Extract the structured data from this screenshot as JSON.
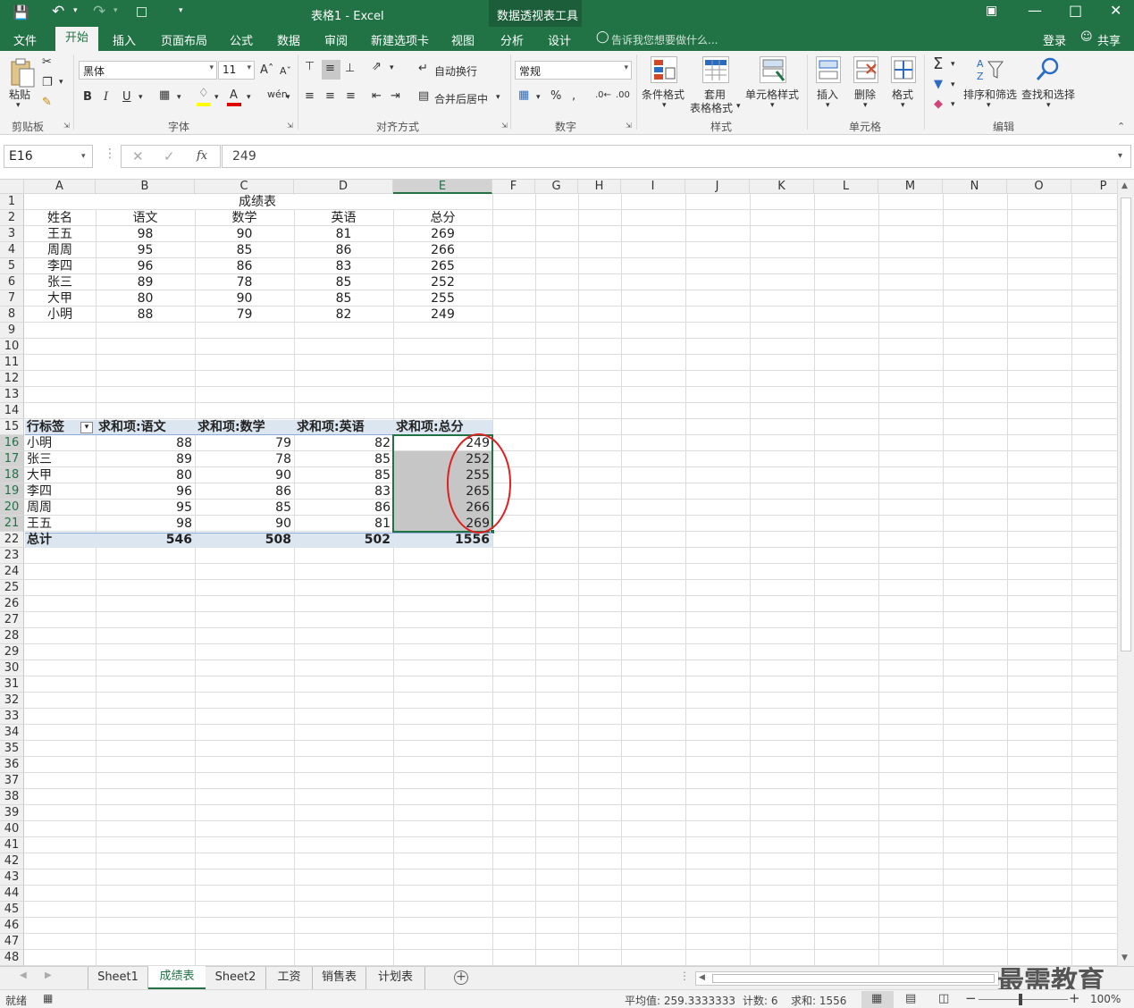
{
  "title": {
    "doc_title": "表格1 - Excel",
    "context_tool": "数据透视表工具"
  },
  "tabs": {
    "file": "文件",
    "items": [
      "开始",
      "插入",
      "页面布局",
      "公式",
      "数据",
      "审阅",
      "新建选项卡",
      "视图",
      "分析",
      "设计"
    ],
    "active": "开始",
    "tell_me": "告诉我您想要做什么...",
    "login": "登录",
    "share": "共享"
  },
  "ribbon": {
    "clipboard": {
      "paste": "粘贴",
      "group": "剪贴板"
    },
    "font": {
      "name": "黑体",
      "size": "11",
      "group": "字体"
    },
    "alignment": {
      "wrap": "自动换行",
      "merge": "合并后居中",
      "group": "对齐方式"
    },
    "number": {
      "format": "常规",
      "group": "数字"
    },
    "styles": {
      "conditional": "条件格式",
      "table_line1": "套用",
      "table_line2": "表格格式",
      "cell_styles": "单元格样式",
      "group": "样式"
    },
    "cells": {
      "insert": "插入",
      "delete": "删除",
      "format": "格式",
      "group": "单元格"
    },
    "editing": {
      "sort": "排序和筛选",
      "find": "查找和选择",
      "group": "编辑"
    }
  },
  "formula_bar": {
    "name_box": "E16",
    "fx": "fx",
    "value": "249"
  },
  "columns": [
    "A",
    "B",
    "C",
    "D",
    "E",
    "F",
    "G",
    "H",
    "I",
    "J",
    "K",
    "L",
    "M",
    "N",
    "O",
    "P"
  ],
  "row_numbers": [
    "1",
    "2",
    "3",
    "4",
    "5",
    "6",
    "7",
    "8",
    "9",
    "10",
    "11",
    "12",
    "13",
    "14",
    "15",
    "16",
    "17",
    "18",
    "19",
    "20",
    "21",
    "22",
    "23",
    "24",
    "25",
    "26",
    "27",
    "28",
    "29",
    "30",
    "31",
    "32",
    "33",
    "34",
    "35",
    "36",
    "37",
    "38",
    "39",
    "40",
    "41",
    "42",
    "43",
    "44",
    "45",
    "46",
    "47",
    "48"
  ],
  "cells": {
    "title": "成绩表",
    "header": [
      "姓名",
      "语文",
      "数学",
      "英语",
      "总分"
    ],
    "rows": [
      [
        "王五",
        "98",
        "90",
        "81",
        "269"
      ],
      [
        "周周",
        "95",
        "85",
        "86",
        "266"
      ],
      [
        "李四",
        "96",
        "86",
        "83",
        "265"
      ],
      [
        "张三",
        "89",
        "78",
        "85",
        "252"
      ],
      [
        "大甲",
        "80",
        "90",
        "85",
        "255"
      ],
      [
        "小明",
        "88",
        "79",
        "82",
        "249"
      ]
    ]
  },
  "pivot": {
    "header": [
      "行标签",
      "求和项:语文",
      "求和项:数学",
      "求和项:英语",
      "求和项:总分"
    ],
    "rows": [
      [
        "小明",
        "88",
        "79",
        "82",
        "249"
      ],
      [
        "张三",
        "89",
        "78",
        "85",
        "252"
      ],
      [
        "大甲",
        "80",
        "90",
        "85",
        "255"
      ],
      [
        "李四",
        "96",
        "86",
        "83",
        "265"
      ],
      [
        "周周",
        "95",
        "85",
        "86",
        "266"
      ],
      [
        "王五",
        "98",
        "90",
        "81",
        "269"
      ]
    ],
    "total": [
      "总计",
      "546",
      "508",
      "502",
      "1556"
    ]
  },
  "sheet_tabs": {
    "items": [
      "Sheet1",
      "成绩表",
      "Sheet2",
      "工资",
      "销售表",
      "计划表"
    ],
    "active": "成绩表"
  },
  "status": {
    "ready": "就绪",
    "average": "平均值: 259.3333333",
    "count": "计数: 6",
    "sum": "求和: 1556",
    "zoom": "100%"
  },
  "watermark": "最需教育",
  "colors": {
    "brand": "#217346",
    "pivot_header": "#dce6f1",
    "selection_fill": "#c6c6c6",
    "annotation": "#e02020"
  }
}
